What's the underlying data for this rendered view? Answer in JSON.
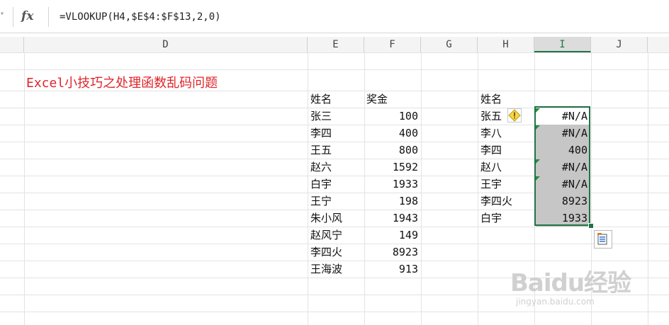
{
  "formula_bar": {
    "fx_label": "fx",
    "formula": "=VLOOKUP(H4,$E$4:$F$13,2,0)"
  },
  "columns": [
    "D",
    "E",
    "F",
    "G",
    "H",
    "I",
    "J"
  ],
  "selected_column": "I",
  "title": "Excel小技巧之处理函数乱码问题",
  "table1": {
    "header_name": "姓名",
    "header_bonus": "奖金",
    "rows": [
      {
        "name": "张三",
        "bonus": "100"
      },
      {
        "name": "李四",
        "bonus": "400"
      },
      {
        "name": "王五",
        "bonus": "800"
      },
      {
        "name": "赵六",
        "bonus": "1592"
      },
      {
        "name": "白宇",
        "bonus": "1933"
      },
      {
        "name": "王宁",
        "bonus": "198"
      },
      {
        "name": "朱小风",
        "bonus": "1943"
      },
      {
        "name": "赵风宁",
        "bonus": "149"
      },
      {
        "name": "李四火",
        "bonus": "8923"
      },
      {
        "name": "王海波",
        "bonus": "913"
      }
    ]
  },
  "table2": {
    "header_name": "姓名",
    "rows": [
      {
        "name": "张五",
        "result": "#N/A"
      },
      {
        "name": "李八",
        "result": "#N/A"
      },
      {
        "name": "李四",
        "result": "400"
      },
      {
        "name": "赵八",
        "result": "#N/A"
      },
      {
        "name": "王宇",
        "result": "#N/A"
      },
      {
        "name": "李四火",
        "result": "8923"
      },
      {
        "name": "白宇",
        "result": "1933"
      }
    ]
  },
  "watermark": {
    "main": "Baidu经验",
    "sub": "jingyan.baidu.com"
  },
  "icons": {
    "warning": "warning-icon",
    "paste_options": "paste-options-icon"
  },
  "colors": {
    "title": "#e0242a",
    "selection_border": "#217346",
    "selection_fill": "#c6c6c6",
    "error_triangle": "#1f8f3a"
  }
}
